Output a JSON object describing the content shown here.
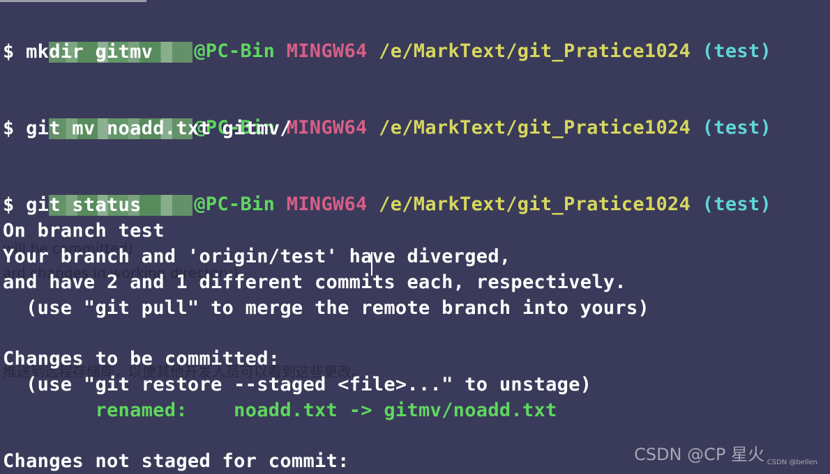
{
  "terminal": {
    "prompt_host": "@PC-Bin",
    "prompt_system": "MINGW64",
    "prompt_path": "/e/MarkText/git_Pratice1024",
    "prompt_branch": "(test)",
    "commands": [
      "$ mkdir gitmv",
      "$ git mv noadd.txt gitmv/",
      "$ git status"
    ],
    "output": {
      "branch_line": "On branch test",
      "diverged_line": "Your branch and 'origin/test' have diverged,",
      "commits_line": "and have 2 and 1 different commits each, respectively.",
      "pull_hint": "  (use \"git pull\" to merge the remote branch into yours)",
      "changes_header": "Changes to be committed:",
      "restore_hint": "  (use \"git restore --staged <file>...\" to unstage)",
      "renamed_label": "        renamed:    ",
      "renamed_value": "noadd.txt -> gitmv/noadd.txt",
      "not_staged_header": "Changes not staged for commit:"
    },
    "ghost_text": {
      "line1": "will be committed)",
      "line2": "ard changes in working directory)",
      "line3": "推送到远程存储库，以便其他开发人员可以看到这些更改。"
    }
  },
  "watermark": {
    "main": "CSDN @CP 星火",
    "small": "CSDN @bellen"
  },
  "colors": {
    "background": "#3a3a5a",
    "host": "#5fd75f",
    "system": "#d75f87",
    "path": "#d7d75f",
    "branch": "#5fd7d7",
    "text": "#ffffff"
  }
}
